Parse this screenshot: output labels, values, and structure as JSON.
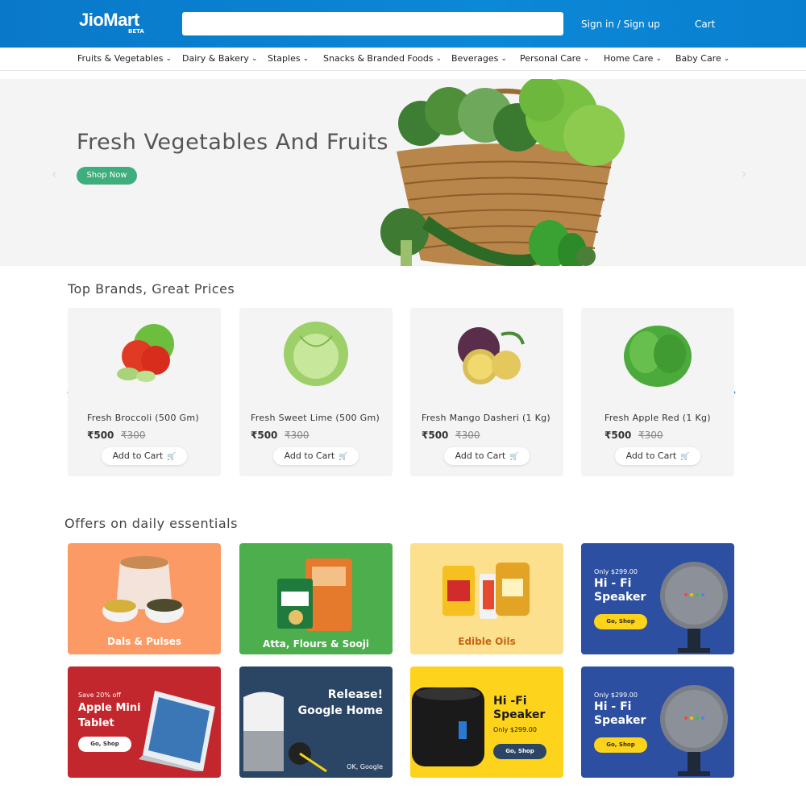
{
  "header": {
    "logo": "JioMart",
    "logo_badge": "BETA",
    "search_placeholder": "",
    "signin": "Sign in / Sign up",
    "cart": "Cart"
  },
  "nav": [
    {
      "label": "Fruits & Vegetables"
    },
    {
      "label": "Dairy & Bakery"
    },
    {
      "label": "Staples"
    },
    {
      "label": "Snacks & Branded Foods"
    },
    {
      "label": "Beverages"
    },
    {
      "label": "Personal Care"
    },
    {
      "label": "Home Care"
    },
    {
      "label": "Baby Care"
    }
  ],
  "hero": {
    "title": "Fresh Vegetables And Fruits",
    "button": "Shop Now"
  },
  "brands": {
    "title": "Top Brands, Great Prices",
    "items": [
      {
        "name": "Fresh Broccoli (500 Gm)",
        "price": "₹500",
        "old_price": "₹300",
        "button": "Add to Cart"
      },
      {
        "name": "Fresh Sweet Lime (500 Gm)",
        "price": "₹500",
        "old_price": "₹300",
        "button": "Add to Cart"
      },
      {
        "name": "Fresh Mango Dasheri (1 Kg)",
        "price": "₹500",
        "old_price": "₹300",
        "button": "Add to Cart"
      },
      {
        "name": "Fresh Apple Red (1 Kg)",
        "price": "₹500",
        "old_price": "₹300",
        "button": "Add to Cart"
      }
    ]
  },
  "offers": {
    "title": "Offers on daily essentials",
    "dals": "Dals & Pulses",
    "atta": "Atta, Flours & Sooji",
    "oils": "Edible Oils",
    "speaker1": {
      "small": "Only $299.00",
      "big": "Hi - Fi Speaker",
      "button": "Go, Shop"
    },
    "tablet": {
      "small": "Save 20% off",
      "big": "Apple Mini Tablet",
      "button": "Go, Shop"
    },
    "google": {
      "big": "Release! Google Home",
      "small": "OK, Google"
    },
    "speaker2": {
      "big": "Hi -Fi Speaker",
      "small": "Only $299.00",
      "button": "Go, Shop"
    },
    "speaker3": {
      "small": "Only $299.00",
      "big": "Hi - Fi Speaker",
      "button": "Go, Shop"
    }
  },
  "colors": {
    "header": "#0a82d1",
    "accent_green": "#3fae7e",
    "dals_bg": "#fb9a64",
    "atta_bg": "#4cae4c",
    "oils_bg": "#fde08e",
    "speaker_bg": "#2d4fa1",
    "tablet_bg": "#c2272d",
    "google_bg": "#2b4565",
    "yellow_bg": "#fdd31b"
  }
}
